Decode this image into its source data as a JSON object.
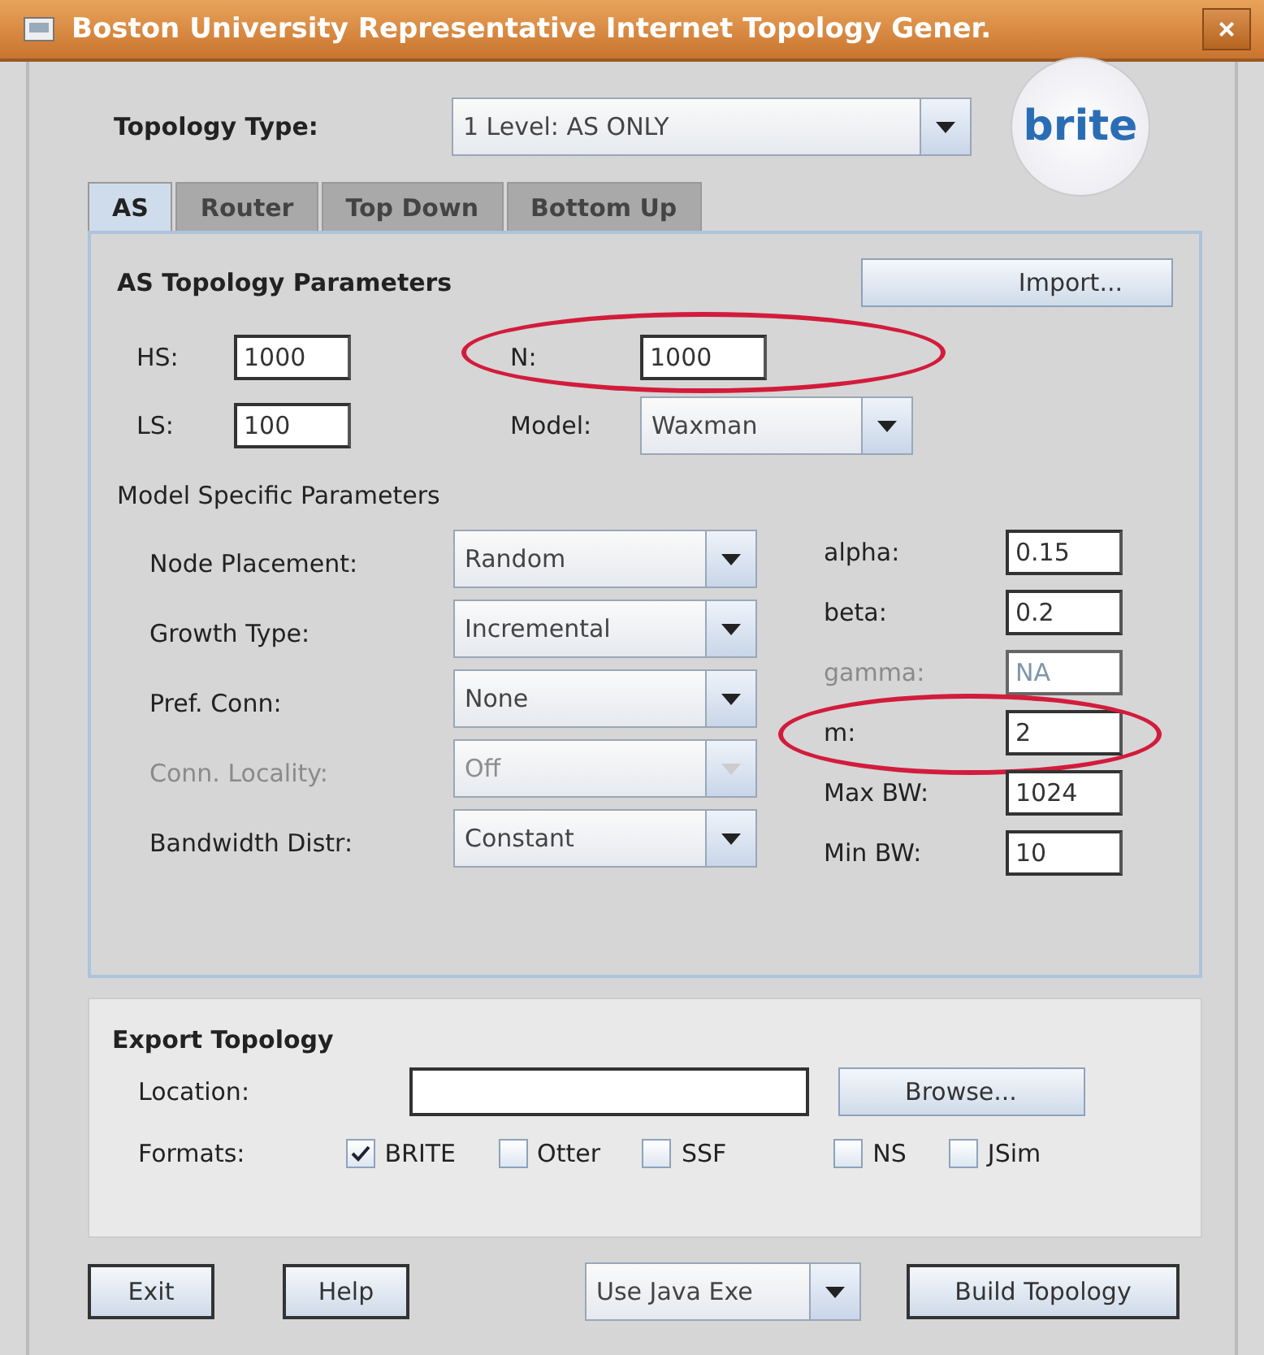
{
  "window": {
    "title": "Boston University Representative Internet Topology Gener.",
    "close": "×"
  },
  "topology_type": {
    "label": "Topology Type:",
    "value": "1 Level: AS ONLY"
  },
  "logo": {
    "text": "brite"
  },
  "tabs": [
    {
      "label": "AS",
      "selected": true
    },
    {
      "label": "Router",
      "selected": false
    },
    {
      "label": "Top Down",
      "selected": false
    },
    {
      "label": "Bottom Up",
      "selected": false
    }
  ],
  "as_parameters": {
    "title": "AS Topology Parameters",
    "import_button": "Import...",
    "size_fields": [
      {
        "label": "HS:",
        "value": "1000"
      },
      {
        "label": "LS:",
        "value": "100"
      }
    ],
    "n_field": {
      "label": "N:",
      "value": "1000",
      "circled": true
    },
    "model": {
      "label": "Model:",
      "value": "Waxman"
    }
  },
  "model_specific": {
    "title": "Model Specific Parameters",
    "options": [
      {
        "label": "Node Placement:",
        "value": "Random",
        "disabled": false
      },
      {
        "label": "Growth Type:",
        "value": "Incremental",
        "disabled": false
      },
      {
        "label": "Pref. Conn:",
        "value": "None",
        "disabled": false
      },
      {
        "label": "Conn. Locality:",
        "value": "Off",
        "disabled": true
      },
      {
        "label": "Bandwidth Distr:",
        "value": "Constant",
        "disabled": false
      }
    ],
    "params": [
      {
        "label": "alpha:",
        "value": "0.15",
        "disabled": false,
        "circled": false
      },
      {
        "label": "beta:",
        "value": "0.2",
        "disabled": false,
        "circled": false
      },
      {
        "label": "gamma:",
        "value": "NA",
        "disabled": true,
        "circled": false
      },
      {
        "label": "m:",
        "value": "2",
        "disabled": false,
        "circled": true
      },
      {
        "label": "Max BW:",
        "value": "1024",
        "disabled": false,
        "circled": false
      },
      {
        "label": "Min BW:",
        "value": "10",
        "disabled": false,
        "circled": false
      }
    ]
  },
  "export": {
    "title": "Export Topology",
    "location_label": "Location:",
    "browse_button": "Browse...",
    "formats_label": "Formats:",
    "formats": [
      {
        "label": "BRITE",
        "checked": true
      },
      {
        "label": "Otter",
        "checked": false
      },
      {
        "label": "SSF",
        "checked": false
      },
      {
        "label": "NS",
        "checked": false
      },
      {
        "label": "JSim",
        "checked": false
      }
    ]
  },
  "bottom": {
    "exit_button": "Exit",
    "help_button": "Help",
    "exec_option": "Use Java Exe",
    "build_button": "Build Topology"
  }
}
